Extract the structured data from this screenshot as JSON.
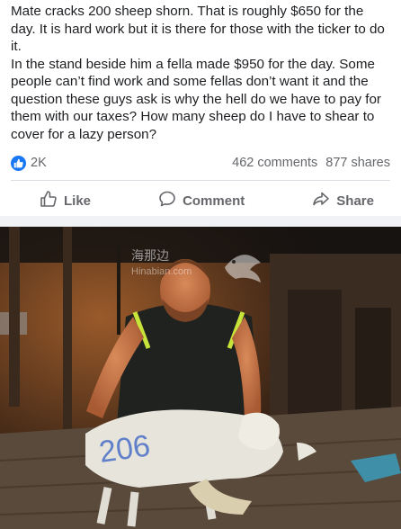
{
  "post": {
    "paragraphs": [
      "Mate cracks 200 sheep shorn. That is roughly $650 for the day. It is hard work but it is there for those with the ticker to do it.",
      "In the stand beside him a fella made $950 for the day. Some people can’t find work and some fellas don’t want it and the question these guys ask is why the hell do we have to pay for them with our taxes? How many sheep do I have to shear to cover for a lazy person?"
    ]
  },
  "stats": {
    "likes": "2K",
    "comments": "462 comments",
    "shares": "877 shares"
  },
  "actions": {
    "like": "Like",
    "comment": "Comment",
    "share": "Share"
  },
  "photo": {
    "watermark": "海那边",
    "watermark_sub": "Hinabian.com",
    "sheep_marking": "206"
  },
  "colors": {
    "like_badge": "#1877f2",
    "muted_text": "#65676b",
    "body_text": "#1c1e21"
  },
  "icons": {
    "like_badge": "thumbs-up-icon",
    "like_action": "thumbs-up-outline-icon",
    "comment_action": "speech-bubble-icon",
    "share_action": "share-arrow-icon"
  }
}
